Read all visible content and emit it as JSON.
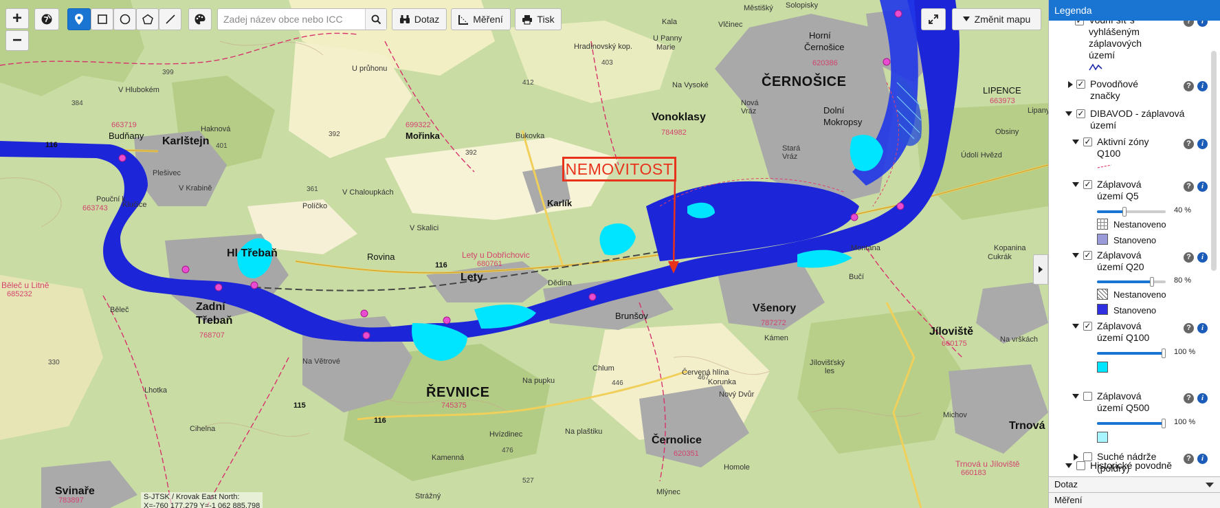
{
  "toolbar": {
    "zoom_in": "+",
    "zoom_out": "−",
    "search_placeholder": "Zadej název obce nebo ICC",
    "dotaz_label": "Dotaz",
    "mereni_label": "Měření",
    "tisk_label": "Tisk",
    "change_map_label": "Změnit mapu"
  },
  "map": {
    "marker_label": "NEMOVITOST",
    "coords_line1": "S-JTSK / Krovak East North:",
    "coords_line2": "X=-760 177.279 Y=-1 062 885.798",
    "towns": {
      "karlstejn": "Karlštejn",
      "cernosice": "ČERNOŠICE",
      "revnice": "ŘEVNICE",
      "zadni_treban": "Zadní",
      "zadni_treban2": "Třebaň",
      "hl_treban": "Hl  Třebaň",
      "lety": "Lety",
      "vonoklasy": "Vonoklasy",
      "vsenory": "Všenory",
      "jiloviste": "Jíloviště",
      "cernolice": "Černolice",
      "svinare": "Svinaře",
      "karlik": "Karlík",
      "dolni_mokropsy": "Dolní",
      "dolni_mokropsy2": "Mokropsy",
      "horni_cernosice": "Horní",
      "horni_cernosice2": "Černošice",
      "lipence": "LIPENCE",
      "trnova": "Trnová",
      "morinka": "Mořinka",
      "budnany": "Budňany",
      "brunsov": "Brunšov",
      "rovina": "Rovina",
      "belec": "Běleč",
      "lhotka": "Lhotka",
      "na_vetrove": "Na Větrové",
      "na_pupku": "Na pupku",
      "na_plastiku": "Na plaštiku",
      "bukovka": "Bukovka",
      "u_panny_marie": "U Panny",
      "u_panny_marie2": "Marie",
      "kala": "Kala",
      "montana": "Montana",
      "buci": "Bučí",
      "michov": "Michov",
      "nova_vraz": "Nová",
      "nova_vraz2": "Vráz",
      "stara_vraz": "Stará",
      "stara_vraz2": "Vráz",
      "dedina": "Dědina",
      "kamen": "Kámen",
      "cihelna": "Cihelna",
      "korunka": "Korunka",
      "novy_dvur": "Nový Dvůr",
      "homole": "Homole",
      "mlynec": "Mlýnec",
      "cukrak": "Cukrák",
      "kopanina": "Kopanina",
      "obsiny": "Obsiny",
      "lipany": "Lipany",
      "udoli_hvezd": "Údolí Hvězd",
      "v_hlubokem": "V Hlubokém",
      "upruhonu": "U průhonu",
      "v_chaloupkach": "V Chaloupkách",
      "pocernik": "Pouční k",
      "klucice": "Klučice",
      "v_krabine": "V Krabině",
      "strazny": "Strážný",
      "hvizdinec": "Hvízdinec",
      "kamenna": "Kamenná",
      "chlum": "Chlum",
      "cervena_hlina": "Červená hlína",
      "jilovistsky_les": "Jílovišťský",
      "jilovistsky_les2": "les",
      "na_vrskach": "Na vrškách",
      "lety_u_dobrichovic": "Lety u Dobřichovic",
      "belec_u_litne": "Běleč u Litně",
      "trnova_u_jil": "Trnová u Jíloviště",
      "solopisky": "Solopisky",
      "mestisky": "Městišký",
      "vlcinec": "Vlčinec",
      "na_vysoke": "Na Vysoké",
      "hradinovsky_kop": "Hradínovský kop.",
      "pisticek": "Plešivec",
      "vsk_kalich": "V Skalici",
      "policko": "Políčko",
      "hajnicky": "Haknová"
    },
    "codes": {
      "c1": "663719",
      "c2": "699322",
      "c3": "784982",
      "c4": "620386",
      "c5": "663743",
      "c6": "680761",
      "c7": "685232",
      "c8": "787272",
      "c9": "745375",
      "c10": "620351",
      "c11": "660175",
      "c12": "663973",
      "c13": "660183",
      "c14": "783897",
      "c15": "768707"
    },
    "roads": {
      "r116a": "116",
      "r116b": "116",
      "r116c": "116",
      "r115": "115"
    },
    "hills": {
      "h399": "399",
      "h384": "384",
      "h401": "401",
      "h361": "361",
      "h392": "392",
      "h412": "412",
      "h403": "403",
      "h446": "446",
      "h476": "476",
      "h467": "467",
      "h330": "330",
      "h527": "527",
      "h392b": "392"
    }
  },
  "legend": {
    "title": "Legenda",
    "items": [
      {
        "label_lines": [
          "Vodní síť s",
          "vyhlášeným",
          "záplavových",
          "území"
        ],
        "checked": true
      },
      {
        "label_lines": [
          "Povodňové",
          "značky"
        ],
        "checked": true
      },
      {
        "label_lines": [
          "DIBAVOD - záplavová",
          "území"
        ],
        "checked": true
      },
      {
        "label_lines": [
          "Aktivní zóny",
          "Q100"
        ],
        "checked": true
      },
      {
        "label_lines": [
          "Záplavová",
          "území Q5"
        ],
        "checked": true,
        "opacity": "40 %",
        "opacity_value": 40
      },
      {
        "label_lines": [
          "Záplavová",
          "území Q20"
        ],
        "checked": true,
        "opacity": "80 %",
        "opacity_value": 80
      },
      {
        "label_lines": [
          "Záplavová",
          "území Q100"
        ],
        "checked": true,
        "opacity": "100 %",
        "opacity_value": 100
      },
      {
        "label_lines": [
          "Záplavová",
          "území Q500"
        ],
        "checked": false,
        "opacity": "100 %",
        "opacity_value": 100
      },
      {
        "label_lines": [
          "Suché nádrže",
          "(poldry)"
        ],
        "checked": false
      },
      {
        "label_lines": [
          "Historické povodně"
        ],
        "checked": false
      }
    ],
    "sub": {
      "q5_nest": "Nestanoveno",
      "q5_stan": "Stanoveno",
      "q20_nest": "Nestanoveno",
      "q20_stan": "Stanoveno"
    },
    "icons": {
      "help": "?",
      "info": "i"
    },
    "colors": {
      "q5": "#9a9ad8",
      "q20": "#3030e0",
      "q100": "#00e5ff",
      "q500": "#a8f4ff"
    }
  },
  "sections": {
    "dotaz": "Dotaz",
    "mereni": "Měření"
  }
}
